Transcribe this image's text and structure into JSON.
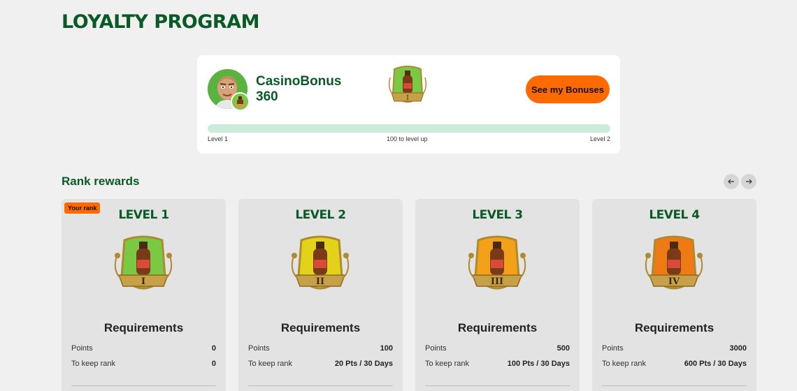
{
  "page": {
    "title": "LOYALTY PROGRAM"
  },
  "profile": {
    "username": "CasinoBonus",
    "points": "360",
    "bonus_button": "See my Bonuses",
    "progress": {
      "fraction": 0.0,
      "left_label": "Level 1",
      "center_label": "100 to level up",
      "right_label": "Level 2"
    }
  },
  "rewards": {
    "title": "Rank rewards",
    "prev_icon": "arrow-left-icon",
    "next_icon": "arrow-right-icon",
    "your_rank_label": "Your rank",
    "cards": [
      {
        "level": "LEVEL 1",
        "numeral": "I",
        "color": "#7ac943",
        "requirements": "Requirements",
        "points_label": "Points",
        "points": "0",
        "keep_label": "To keep rank",
        "keep": "0"
      },
      {
        "level": "LEVEL 2",
        "numeral": "II",
        "color": "#e3d21a",
        "requirements": "Requirements",
        "points_label": "Points",
        "points": "100",
        "keep_label": "To keep rank",
        "keep": "20 Pts / 30 Days"
      },
      {
        "level": "LEVEL 3",
        "numeral": "III",
        "color": "#f2a118",
        "requirements": "Requirements",
        "points_label": "Points",
        "points": "500",
        "keep_label": "To keep rank",
        "keep": "100 Pts / 30 Days"
      },
      {
        "level": "LEVEL 4",
        "numeral": "IV",
        "color": "#ee7a14",
        "requirements": "Requirements",
        "points_label": "Points",
        "points": "3000",
        "keep_label": "To keep rank",
        "keep": "600 Pts / 30 Days"
      }
    ]
  },
  "colors": {
    "brand_green": "#0a5a26",
    "accent_orange": "#ff6a00",
    "progress_track": "#cdebdb"
  }
}
